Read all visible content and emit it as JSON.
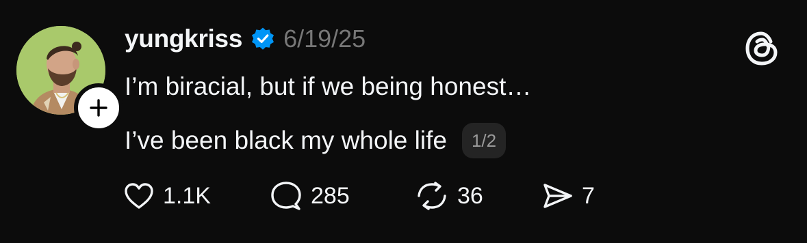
{
  "post": {
    "username": "yungkriss",
    "verified_icon": "verified-badge-icon",
    "date": "6/19/25",
    "text_line_1": "I’m biracial, but if we being honest…",
    "text_line_2": "I’ve been black my whole life",
    "thread_counter": "1/2"
  },
  "actions": {
    "likes": "1.1K",
    "replies": "285",
    "reposts": "36",
    "shares": "7"
  },
  "colors": {
    "background": "#0c0c0c",
    "text": "#f3f5f7",
    "muted": "#777777",
    "verified": "#0095f6",
    "avatar_background": "#a8c86a"
  }
}
